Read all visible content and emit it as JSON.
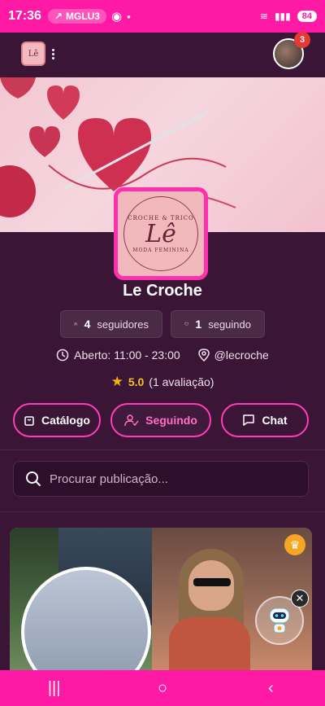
{
  "status_bar": {
    "time": "17:36",
    "ticker": "MGLU3",
    "battery": "84"
  },
  "header": {
    "logo_text": "Lê",
    "notification_count": "3"
  },
  "store": {
    "logo": {
      "top_text": "CROCHE & TRICO",
      "main_text": "Lê",
      "bottom_text": "MODA FEMININA"
    },
    "name": "Le Croche",
    "followers_count": "4",
    "followers_label": "seguidores",
    "following_count": "1",
    "following_label": "seguindo",
    "hours": "Aberto: 11:00 - 23:00",
    "handle": "@lecroche",
    "rating": "5.0",
    "reviews": "(1 avaliação)"
  },
  "actions": {
    "catalog_label": "Catálogo",
    "following_label": "Seguindo",
    "chat_label": "Chat"
  },
  "search": {
    "placeholder": "Procurar publicação..."
  },
  "colors": {
    "accent": "#ff1aa6",
    "background": "#3a1536",
    "star": "#f5b301"
  }
}
